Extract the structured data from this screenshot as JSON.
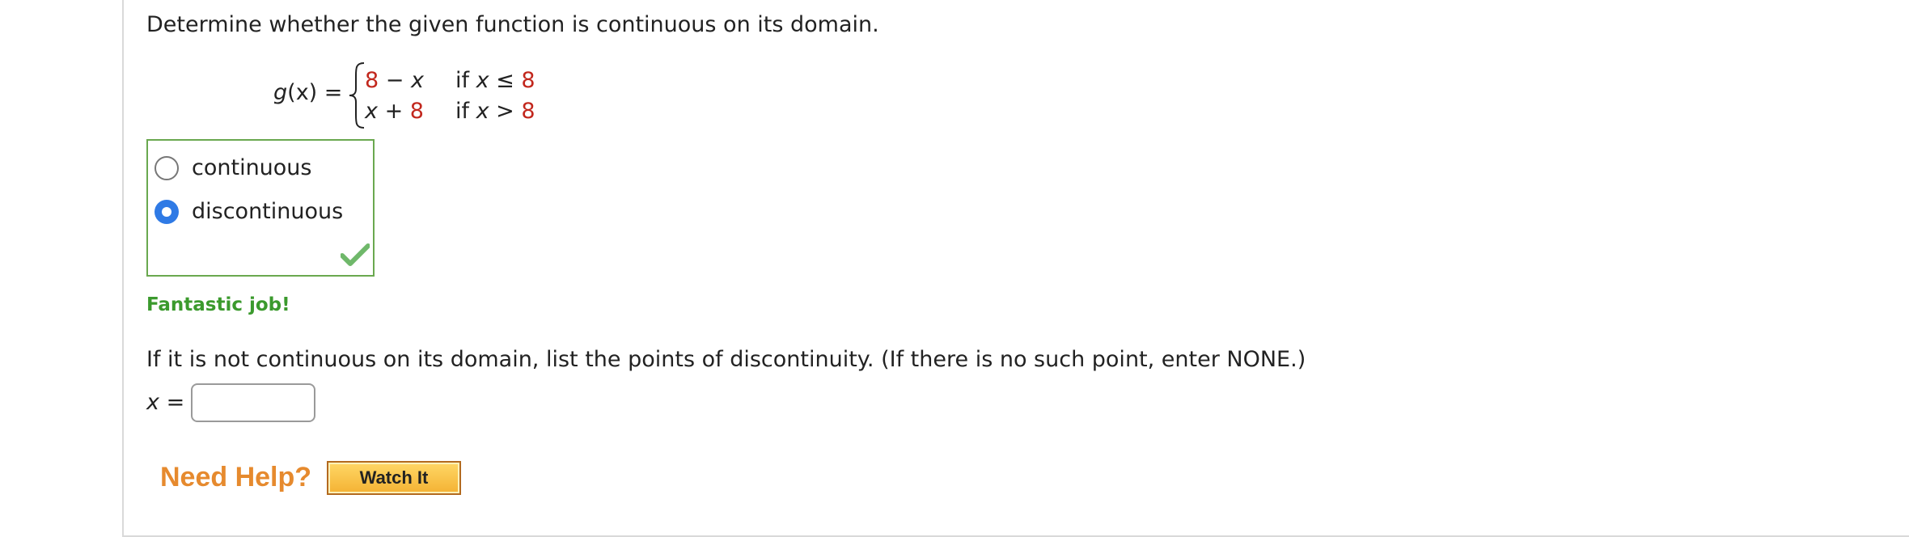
{
  "question1": {
    "prompt": "Determine whether the given function is continuous on its domain."
  },
  "function": {
    "name": "g",
    "variable": "x",
    "equals": "=",
    "case1": {
      "num": "8",
      "op": " − ",
      "var": "x",
      "cond_if": "if ",
      "cond_var": "x",
      "cond_op": " ≤ ",
      "cond_val": "8"
    },
    "case2": {
      "var": "x",
      "op": " + ",
      "num": "8",
      "cond_if": "if ",
      "cond_var": "x",
      "cond_op": " > ",
      "cond_val": "8"
    }
  },
  "choices": {
    "options": [
      {
        "label": "continuous",
        "selected": false
      },
      {
        "label": "discontinuous",
        "selected": true
      }
    ],
    "result_icon": "checkmark-icon"
  },
  "feedback": "Fantastic job!",
  "question2": {
    "prompt": "If it is not continuous on its domain, list the points of discontinuity. (If there is no such point, enter NONE.)",
    "var": "x",
    "equals": " =",
    "answer_value": ""
  },
  "help": {
    "title": "Need Help?",
    "watch_button": "Watch It"
  },
  "colors": {
    "accent_red": "#c2271d",
    "correct_green": "#6aa84f",
    "radio_blue": "#2f7ae5",
    "help_orange": "#e68a2e"
  }
}
